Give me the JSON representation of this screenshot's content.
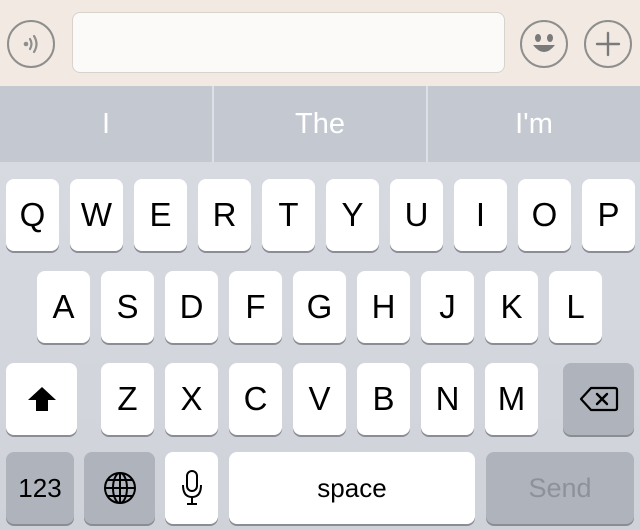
{
  "input_bar": {
    "voice_icon": "voice-waves-icon",
    "message_value": "",
    "message_placeholder": "",
    "emoji_icon": "smiley-face-icon",
    "plus_icon": "plus-icon"
  },
  "suggestions": [
    "I",
    "The",
    "I'm"
  ],
  "keyboard": {
    "row1": [
      "Q",
      "W",
      "E",
      "R",
      "T",
      "Y",
      "U",
      "I",
      "O",
      "P"
    ],
    "row2": [
      "A",
      "S",
      "D",
      "F",
      "G",
      "H",
      "J",
      "K",
      "L"
    ],
    "row3": [
      "Z",
      "X",
      "C",
      "V",
      "B",
      "N",
      "M"
    ],
    "shift_icon": "shift-arrow-icon",
    "backspace_icon": "backspace-icon",
    "numbers_label": "123",
    "globe_icon": "globe-icon",
    "mic_icon": "microphone-icon",
    "space_label": "space",
    "send_label": "Send"
  },
  "colors": {
    "input_bar_bg": "#f2eae2",
    "suggestion_bg": "#c4c9d1",
    "keyboard_bg": "#d4d7dd",
    "key_bg": "#ffffff",
    "dark_key_bg": "#aeb3bc",
    "send_text": "#8e9298"
  }
}
